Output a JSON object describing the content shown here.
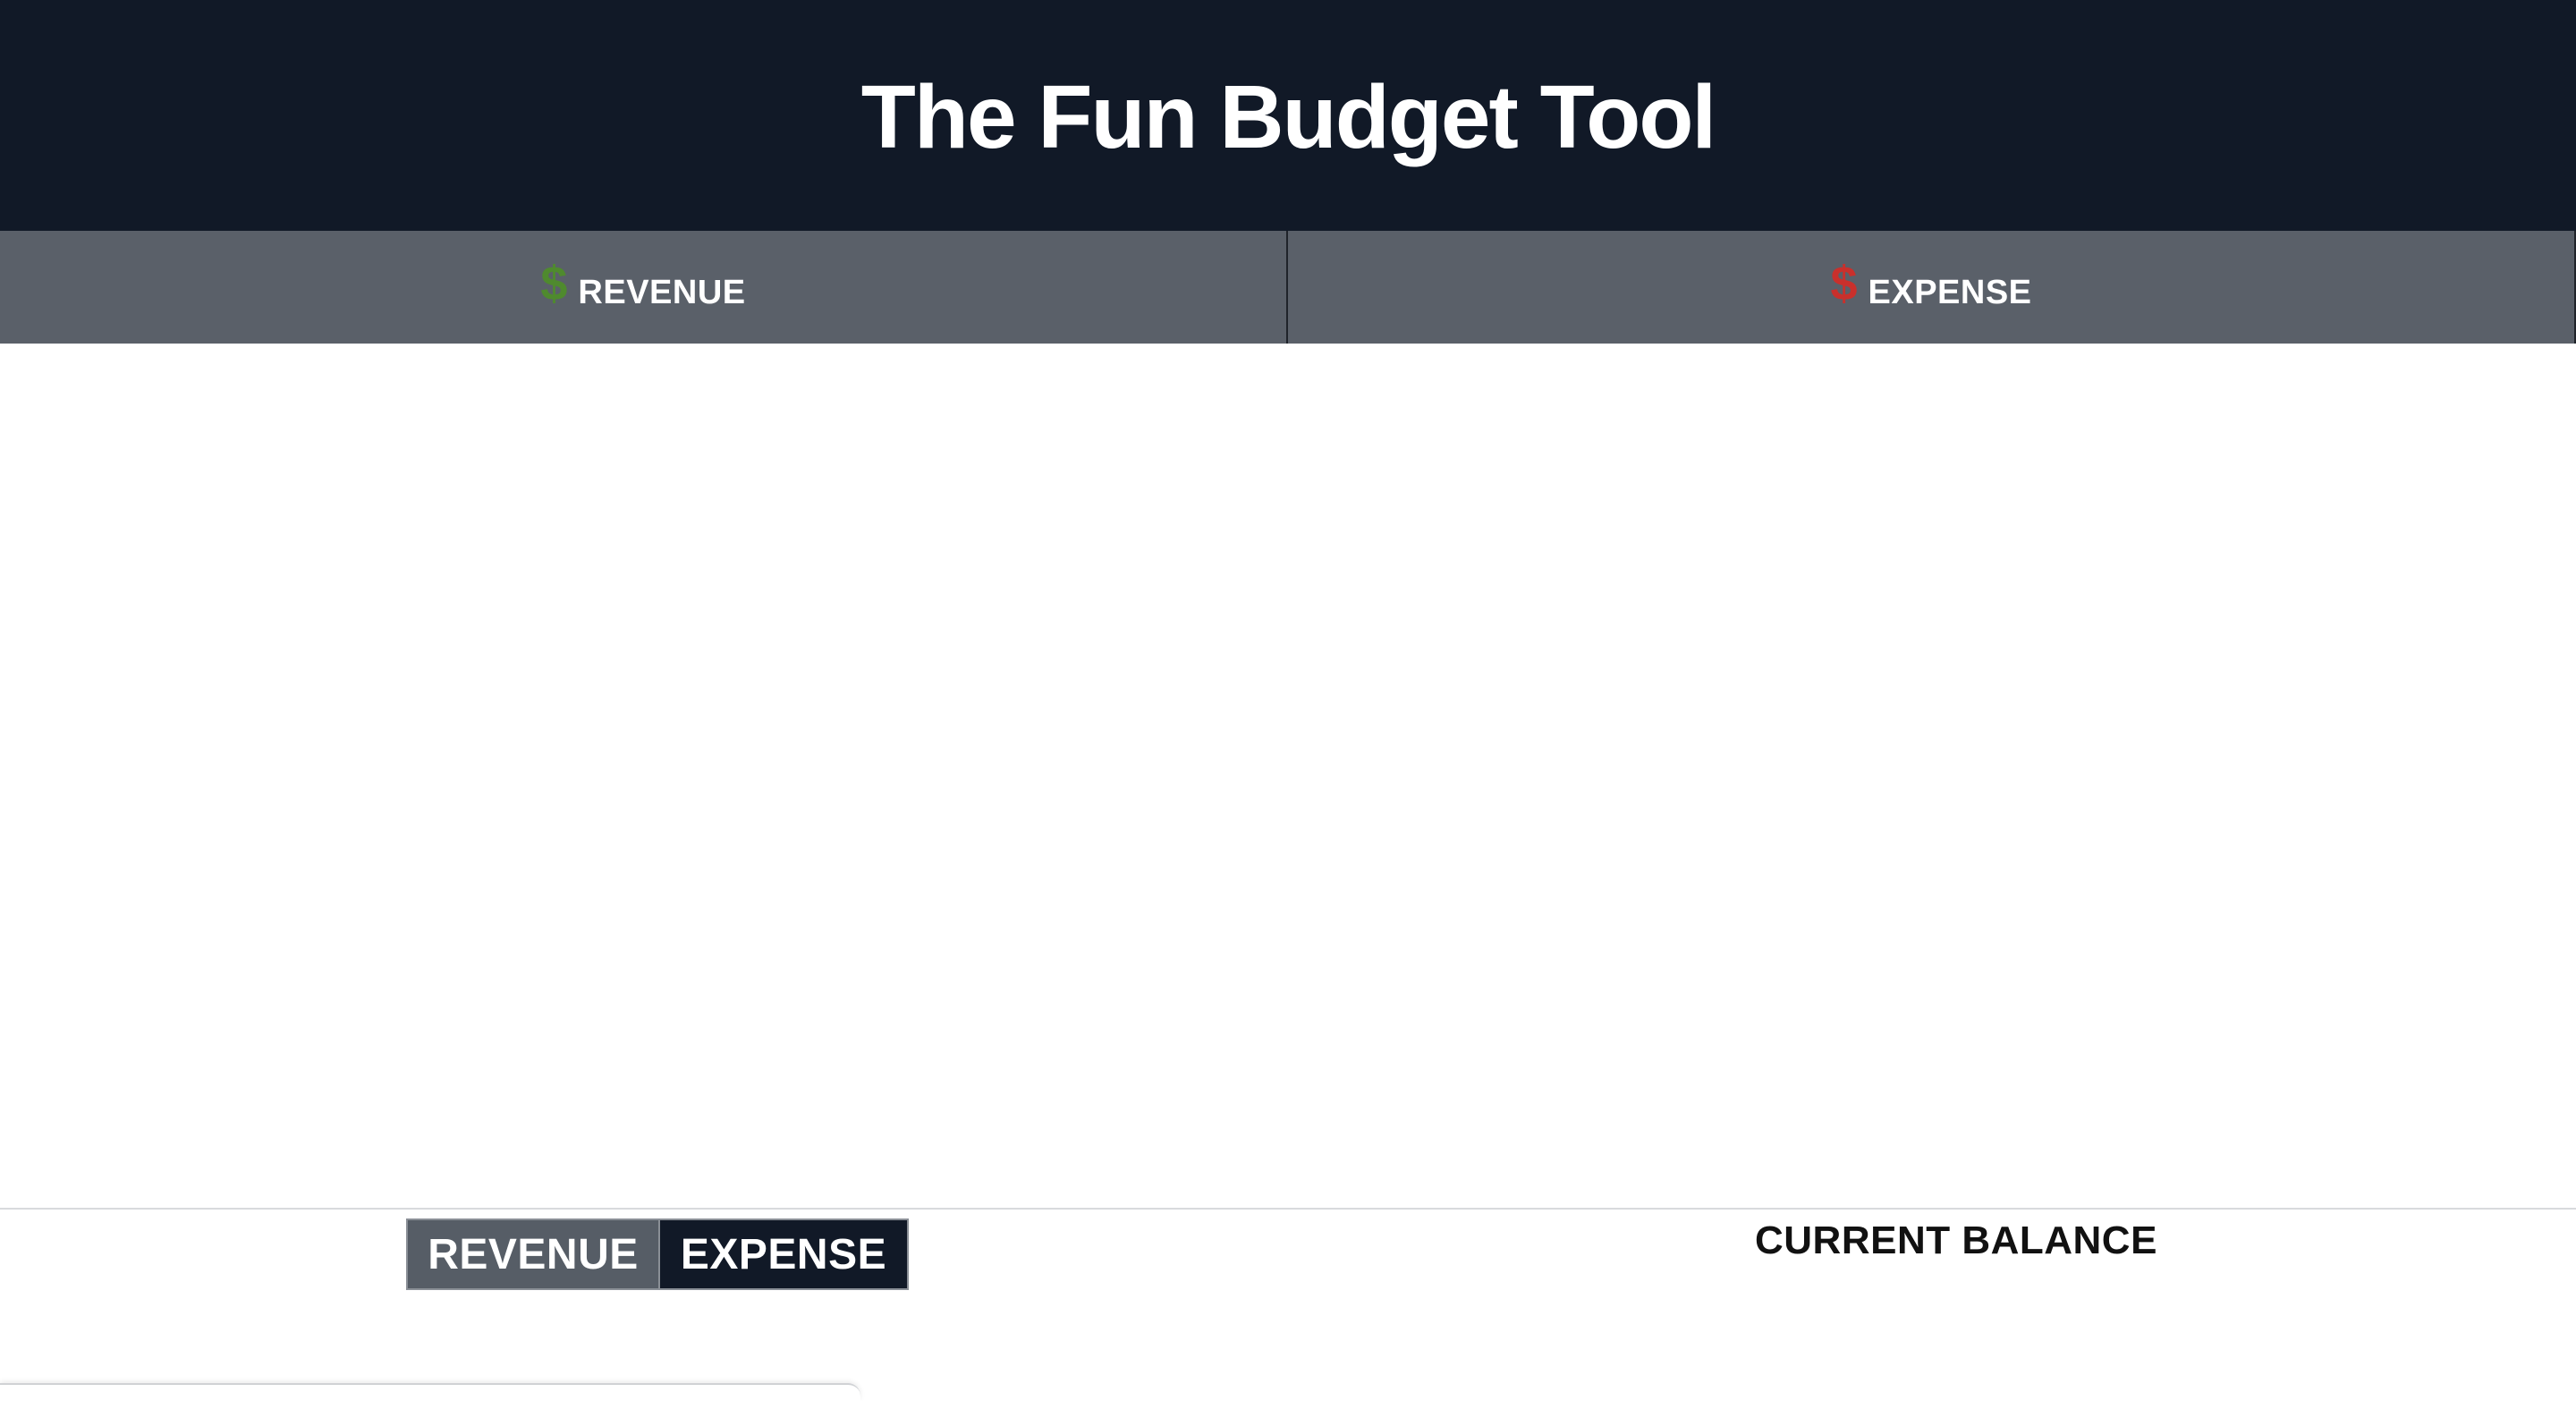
{
  "header": {
    "title": "The Fun Budget Tool"
  },
  "columns": {
    "revenue": {
      "icon": "$",
      "icon_name": "dollar-icon",
      "icon_color": "#4f8a2e",
      "label": "REVENUE"
    },
    "expense": {
      "icon": "$",
      "icon_name": "dollar-icon",
      "icon_color": "#c9302c",
      "label": "EXPENSE"
    }
  },
  "entry_form": {
    "toggle": {
      "revenue_label": "REVENUE",
      "expense_label": "EXPENSE",
      "selected": "EXPENSE"
    }
  },
  "balance": {
    "label": "CURRENT BALANCE"
  },
  "colors": {
    "header_bg": "#111927",
    "column_header_bg": "#5a6069",
    "revenue_accent": "#4f8a2e",
    "expense_accent": "#c9302c"
  }
}
